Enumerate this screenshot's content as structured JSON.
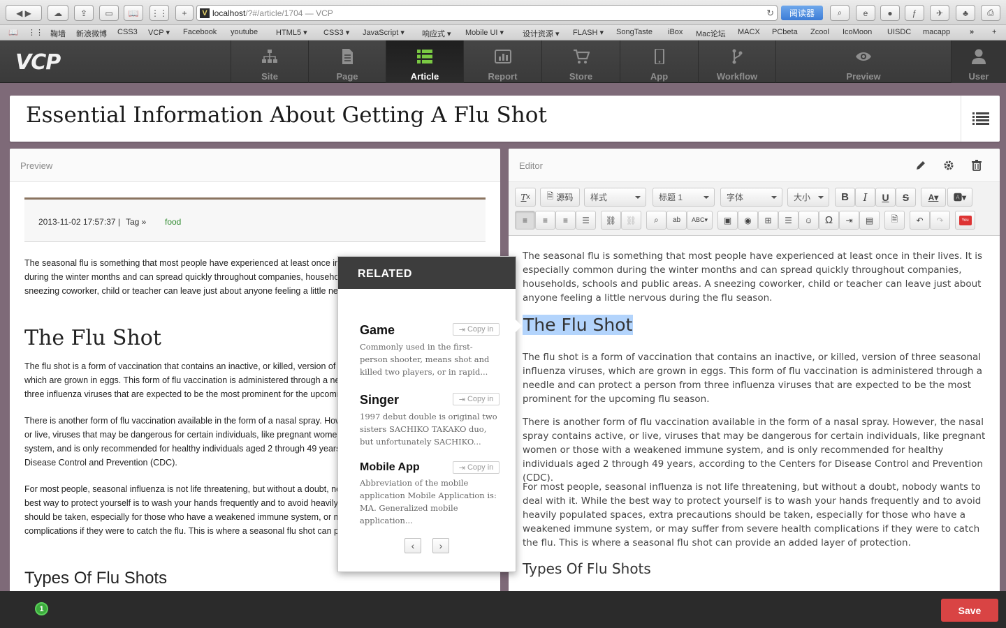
{
  "browser": {
    "url_host": "localhost",
    "url_rest": "/?#/article/1704 — VCP",
    "reader_label": "阅读器",
    "bookmarks": [
      "鞠墙",
      "新浪微博",
      "CSS3",
      "VCP ▾",
      "Facebook",
      "youtube",
      "HTML5 ▾",
      "CSS3 ▾",
      "JavaScript ▾",
      "响应式 ▾",
      "Mobile UI ▾",
      "设计资源 ▾",
      "FLASH ▾",
      "SongTaste",
      "iBox",
      "Mac论坛",
      "MACX",
      "PCbeta",
      "Zcool",
      "IcoMoon",
      "UISDC",
      "macapp"
    ]
  },
  "app": {
    "logo": "VCP",
    "nav": [
      {
        "label": "Site",
        "icon": "sitemap-icon"
      },
      {
        "label": "Page",
        "icon": "page-icon"
      },
      {
        "label": "Article",
        "icon": "list-icon",
        "active": true
      },
      {
        "label": "Report",
        "icon": "chart-icon"
      },
      {
        "label": "Store",
        "icon": "cart-icon"
      },
      {
        "label": "App",
        "icon": "mobile-icon"
      },
      {
        "label": "Workflow",
        "icon": "branch-icon"
      },
      {
        "label": "Preview",
        "icon": "eye-icon"
      },
      {
        "label": "User",
        "icon": "user-icon"
      }
    ]
  },
  "article": {
    "title": "Essential Information About Getting A Flu Shot"
  },
  "preview": {
    "panel_title": "Preview",
    "date": "2013-11-02 17:57:37 |",
    "tag_label": "Tag »",
    "tag_value": "food",
    "p1": "The seasonal flu is something that most people have experienced at least once in their lives. It is especially common during the winter months and can spread quickly throughout companies, households, schools and public areas. A sneezing coworker, child or teacher can leave just about anyone feeling a little nervous during the flu season.",
    "h1": "The Flu Shot",
    "p2": "The flu shot is a form of vaccination that contains an inactive, or killed, version of three seasonal influenza viruses, which are grown in eggs. This form of flu vaccination is administered through a needle and can protect a person from three influenza viruses that are expected to be the most prominent for the upcoming flu season.",
    "p3": "There is another form of flu vaccination available in the form of a nasal spray. However, the nasal spray contains active, or live, viruses that may be dangerous for certain individuals, like pregnant women or those with a weakened immune system, and is only recommended for healthy individuals aged 2 through 49 years, according to the Centers for Disease Control and Prevention (CDC).",
    "p4": "For most people, seasonal influenza is not life threatening, but without a doubt, nobody wants to deal with it. While the best way to protect yourself is to wash your hands frequently and to avoid heavily populated spaces, extra precautions should be taken, especially for those who have a weakened immune system, or may suffer from severe health complications if they were to catch the flu. This is where a seasonal flu shot can provide an added layer of protection.",
    "h2": "Types Of Flu Shots"
  },
  "editor": {
    "panel_title": "Editor",
    "toolbar": {
      "source": "源码",
      "style": "样式",
      "heading": "标题 1",
      "font": "字体",
      "size": "大小"
    },
    "p1": "The seasonal flu is something that most people have experienced at least once in their lives. It is especially common during the winter months and can spread quickly throughout companies, households, schools and public areas. A sneezing coworker, child or teacher can leave just about anyone feeling a little nervous during the flu season.",
    "h1": "The Flu Shot",
    "p2": "The flu shot is a form of vaccination that contains an inactive, or killed, version of three seasonal influenza viruses, which are grown in eggs. This form of flu vaccination is administered through a needle and can protect a person from three influenza viruses that are expected to be the most prominent for the upcoming flu season.",
    "p3": "There is another form of flu vaccination available in the form of a nasal spray. However, the nasal spray contains active, or live, viruses that may be dangerous for certain individuals, like pregnant women or those with a weakened immune system, and is only recommended for healthy individuals aged 2 through 49 years, according to the Centers for Disease Control and Prevention (CDC).",
    "p4": "For most people, seasonal influenza is not life threatening, but without a doubt, nobody wants to deal with it. While the best way to protect yourself is to wash your hands frequently and to avoid heavily populated spaces, extra precautions should be taken, especially for those who have a weakened immune system, or may suffer from severe health complications if they were to catch the flu. This is where a seasonal flu shot can provide an added layer of protection.",
    "h2": "Types Of Flu Shots"
  },
  "related": {
    "heading": "RELATED",
    "copy_label": "Copy in",
    "items": [
      {
        "title": "Game",
        "desc": "Commonly used in the first-person shooter, means shot and killed two players, or in rapid..."
      },
      {
        "title": "Singer",
        "desc": "1997 debut double is original two sisters SACHIKO TAKAKO duo, but unfortunately SACHIKO..."
      },
      {
        "title": "Mobile App",
        "desc": "Abbreviation of the mobile application Mobile Application is: MA. Generalized mobile application..."
      }
    ]
  },
  "footer": {
    "notification_count": "1",
    "save_label": "Save"
  },
  "colors": {
    "accent_green": "#3caa3c",
    "save_red": "#d94444",
    "nav_bg": "#3a3a3a",
    "selection": "#b3d4fc"
  }
}
